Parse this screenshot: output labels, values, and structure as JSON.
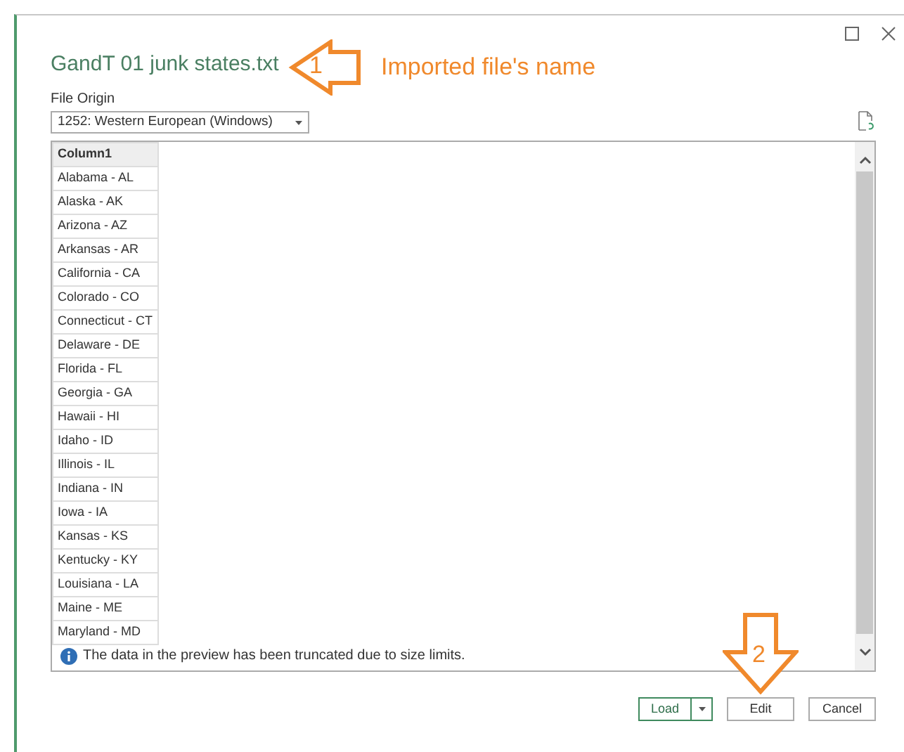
{
  "window": {
    "title": "GandT 01 junk states.txt"
  },
  "file_origin": {
    "label": "File Origin",
    "value": "1252: Western European (Windows)"
  },
  "table": {
    "columns": [
      "Column1"
    ],
    "rows": [
      [
        "Alabama - AL"
      ],
      [
        "Alaska - AK"
      ],
      [
        "Arizona - AZ"
      ],
      [
        "Arkansas - AR"
      ],
      [
        "California - CA"
      ],
      [
        "Colorado - CO"
      ],
      [
        "Connecticut - CT"
      ],
      [
        "Delaware - DE"
      ],
      [
        "Florida - FL"
      ],
      [
        "Georgia - GA"
      ],
      [
        "Hawaii - HI"
      ],
      [
        "Idaho - ID"
      ],
      [
        "Illinois - IL"
      ],
      [
        "Indiana - IN"
      ],
      [
        "Iowa - IA"
      ],
      [
        "Kansas - KS"
      ],
      [
        "Kentucky - KY"
      ],
      [
        "Louisiana - LA"
      ],
      [
        "Maine - ME"
      ],
      [
        "Maryland - MD"
      ]
    ]
  },
  "notice": "The data in the preview has been truncated due to size limits.",
  "buttons": [
    {
      "label": "Load",
      "kind": "split"
    },
    {
      "label": "Edit",
      "kind": "plain"
    },
    {
      "label": "Cancel",
      "kind": "plain"
    }
  ],
  "annotations": [
    {
      "number": "1",
      "text": "Imported file's name",
      "kind": "left"
    },
    {
      "number": "2",
      "kind": "down"
    }
  ]
}
